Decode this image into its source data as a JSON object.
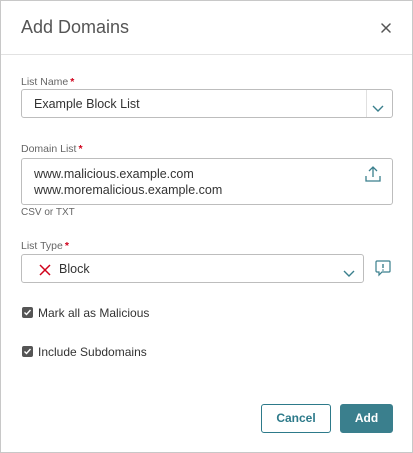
{
  "dialog": {
    "title": "Add Domains",
    "close_icon": "close-icon"
  },
  "list_name": {
    "label": "List Name",
    "required_mark": "*",
    "value": "Example Block List"
  },
  "domain_list": {
    "label": "Domain List",
    "required_mark": "*",
    "lines": [
      "www.malicious.example.com",
      "www.moremalicious.example.com"
    ],
    "hint": "CSV or TXT",
    "upload_icon": "upload-icon"
  },
  "list_type": {
    "label": "List Type",
    "required_mark": "*",
    "value": "Block",
    "value_icon": "x-icon",
    "info_icon": "info-icon"
  },
  "options": {
    "mark_malicious": {
      "label": "Mark all as Malicious",
      "checked": true
    },
    "include_subdomains": {
      "label": "Include Subdomains",
      "checked": true
    }
  },
  "buttons": {
    "cancel": "Cancel",
    "add": "Add"
  },
  "colors": {
    "accent": "#3a7f8d",
    "required": "#d0021b",
    "block_icon": "#d0021b"
  }
}
